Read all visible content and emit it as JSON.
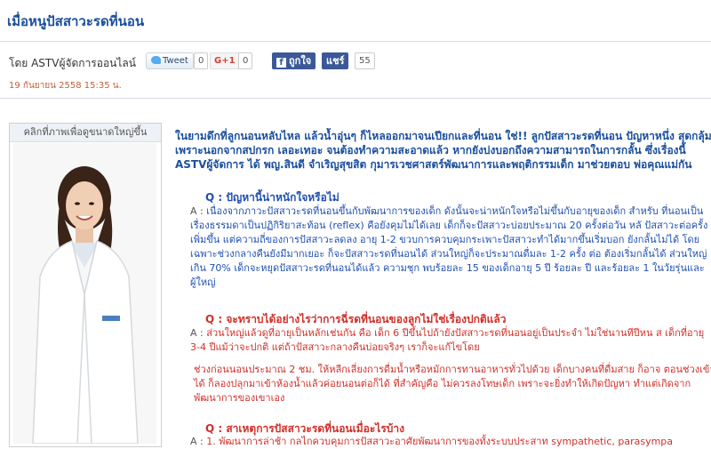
{
  "title": "เมื่อหนูปัสสาวะรดที่นอน",
  "byline": "โดย ASTVผู้จัดการออนไลน์",
  "social": {
    "tweet_label": "Tweet",
    "tweet_count": "0",
    "gplus_label": "G+1",
    "gplus_count": "0",
    "like_label": "ถูกใจ",
    "share_label": "แชร์",
    "share_count": "55"
  },
  "date": "19 กันยายน 2558 15:35 น.",
  "photo": {
    "caption": "คลิกที่ภาพเพื่อดูขนาดใหญ่ขึ้น"
  },
  "article": {
    "intro": "ในยามดึกที่ลูกนอนหลับไหล แล้วน้ำอุ่นๆ ก็ไหลออกมาจนเปียกและที่นอน ใช่!! ลูกปัสสาวะรดที่นอน ปัญหาหนึ่ง สุดกลุ้ม เพราะนอกจากสปกรก เลอะเทอะ จนต้องทำความสะอาดแล้ว หากยังบ่งบอกถึงความสามารถในการกลั้น ซึ่งเรื่องนี้ ASTVผู้จัดการ ได้ พญ.สินดี จำเริญสุขสิต กุมารเวชศาสตร์พัฒนาการและพฤติกรรมเด็ก มาช่วยตอบ พ่อคุณแม่กัน",
    "q1": "Q : ปัญหานี้น่าหนักใจหรือไม่",
    "a1_label": "A : ",
    "a1": "เนื่องจากภาวะปัสสาวะรดที่นอนขึ้นกับพัฒนาการของเด็ก ดังนั้นจะน่าหนักใจหรือไม่ขึ้นกับอายุของเด็ก สำหรับ ที่นอนเป็นเรื่องธรรมดาเป็นปฏิกิริยาสะท้อน (reflex) คือยังคุมไม่ได้เลย เด็กก็จะปัสสาวะบ่อยประมาณ 20 ครั้งต่อวัน หลั ปัสสาวะต่อครั้งเพิ่มขึ้น แต่ความถี่ของการปัสสาวะลดลง อายุ 1-2 ขวบการควบคุมกระเพาะปัสสาวะทำได้มากขึ้นเริ่มบอก ยังกลั้นไม่ได้ โดยเฉพาะช่วงกลางคืนยังมีมากเยอะ ก็จะปัสสาวะรดที่นอนได้ ส่วนใหญ่ก็จะประมาณดื่มละ 1-2 ครั้ง ต่อ ต้องเริ่มกลั้นได้ ส่วนใหญ่ เกิน 70% เด็กจะหยุดปัสสาวะรดที่นอนได้แล้ว ความชุก พบร้อยละ 15 ของเด็กอายุ 5 ปี ร้อยละ ปี และร้อยละ 1 ในวัยรุ่นและผู้ใหญ่",
    "q2": "Q : จะทราบได้อย่างไรว่าการฉี่รดที่นอนของลูกไม่ใช่เรื่องปกติแล้ว",
    "a2_label": "A : ",
    "a2": "ส่วนใหญ่แล้วดูที่อายุเป็นหลักเช่นกัน คือ เด็ก 6 ปีขึ้นไปถ้ายังปัสสาวะรดที่นอนอยู่เป็นประจำ ไม่ใช่นานทีปีหน ส เด็กที่อายุ 3-4 ปีแม้ว่าจะปกติ แต่ถ้าปัสสาวะกลางคืนบ่อยจริงๆ เราก็จะแก้ไขโดย",
    "a2b": "ช่วงก่อนนอนประมาณ 2 ชม. ให้หลีกเลี่ยงการดื่มน้ำหรือหมักการทานอาหารทั่วไปด้วย เด็กบางคนที่ดื่มสาย ก็อาจ ตอนช่วงเข้าได้ ก็ลองปลุกมาเข้าห้องน้ำแล้วค่อยนอนต่อก็ได้ ที่สำคัญคือ ไม่ควรลงโทษเด็ก เพราะจะยิ่งทำให้เกิดปัญหา ทำแต่เกิดจากพัฒนาการของเขาเอง",
    "q3": "Q : สาเหตุการปัสสาวะรดที่นอนเมื่อะไรบ้าง",
    "a3_label": "A : ",
    "a3": "1. พัฒนาการล่าช้า กลไกควบคุมการปัสสาวะอาศัยพัฒนาการของทั้งระบบประสาท sympathetic, parasympa"
  }
}
